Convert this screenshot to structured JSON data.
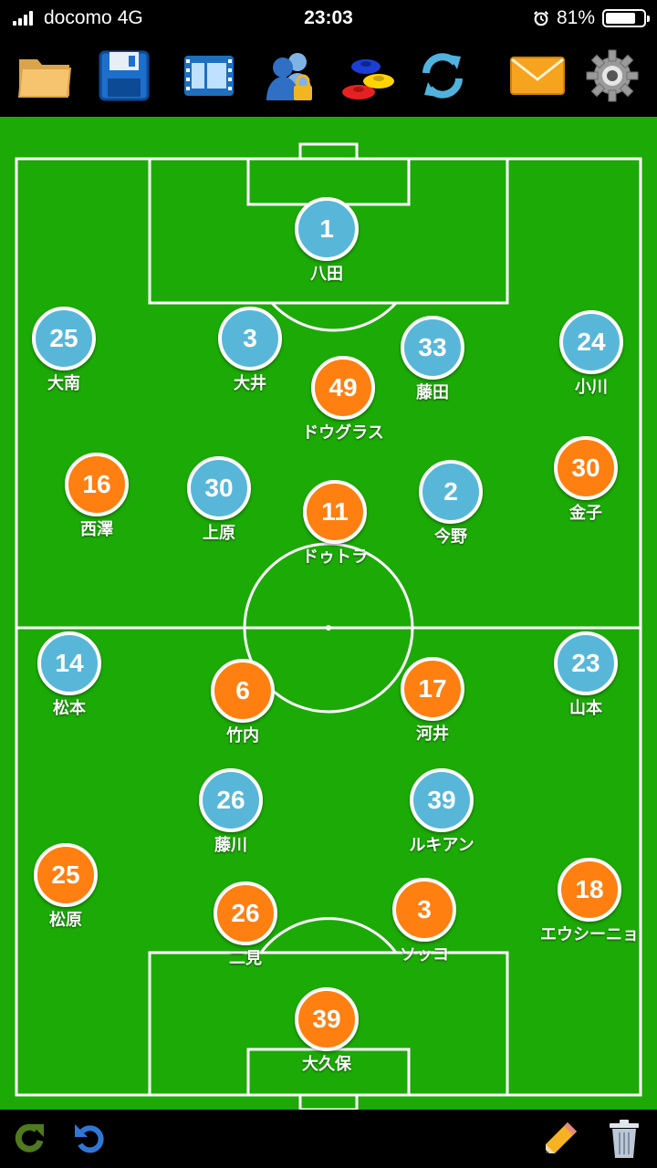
{
  "status": {
    "carrier": "docomo",
    "network": "4G",
    "time": "23:03",
    "battery_percent": "81%",
    "battery_level": 0.81
  },
  "toolbar": {
    "items": [
      {
        "name": "folder-icon"
      },
      {
        "name": "save-icon"
      },
      {
        "name": "film-icon"
      },
      {
        "name": "team-lock-icon"
      },
      {
        "name": "cones-icon"
      },
      {
        "name": "refresh-icon"
      },
      {
        "name": "mail-icon"
      },
      {
        "name": "settings-gear-icon"
      }
    ]
  },
  "colors": {
    "pitch": "#1caa07",
    "team_blue": "#58b7d9",
    "team_orange": "#ff7f11"
  },
  "players": [
    {
      "number": "1",
      "name": "八田",
      "team": "blue"
    },
    {
      "number": "25",
      "name": "大南",
      "team": "blue"
    },
    {
      "number": "3",
      "name": "大井",
      "team": "blue"
    },
    {
      "number": "33",
      "name": "藤田",
      "team": "blue"
    },
    {
      "number": "24",
      "name": "小川",
      "team": "blue"
    },
    {
      "number": "49",
      "name": "ドウグラス",
      "team": "orange"
    },
    {
      "number": "16",
      "name": "西澤",
      "team": "orange"
    },
    {
      "number": "30",
      "name": "上原",
      "team": "blue"
    },
    {
      "number": "11",
      "name": "ドゥトラ",
      "team": "orange"
    },
    {
      "number": "2",
      "name": "今野",
      "team": "blue"
    },
    {
      "number": "30",
      "name": "金子",
      "team": "orange"
    },
    {
      "number": "14",
      "name": "松本",
      "team": "blue"
    },
    {
      "number": "6",
      "name": "竹内",
      "team": "orange"
    },
    {
      "number": "17",
      "name": "河井",
      "team": "orange"
    },
    {
      "number": "23",
      "name": "山本",
      "team": "blue"
    },
    {
      "number": "26",
      "name": "藤川",
      "team": "blue"
    },
    {
      "number": "39",
      "name": "ルキアン",
      "team": "blue"
    },
    {
      "number": "25",
      "name": "松原",
      "team": "orange"
    },
    {
      "number": "26",
      "name": "二見",
      "team": "orange"
    },
    {
      "number": "3",
      "name": "ソッコ",
      "team": "orange"
    },
    {
      "number": "18",
      "name": "エウシーニョ",
      "team": "orange"
    },
    {
      "number": "39",
      "name": "大久保",
      "team": "orange"
    }
  ],
  "bottom": {
    "left": [
      {
        "name": "redo-icon"
      },
      {
        "name": "undo-icon"
      }
    ],
    "right": [
      {
        "name": "pencil-icon"
      },
      {
        "name": "trash-icon"
      }
    ]
  }
}
